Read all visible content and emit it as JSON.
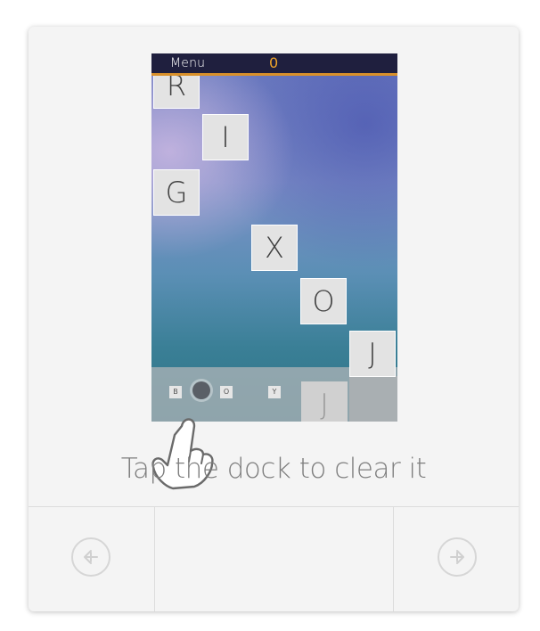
{
  "game": {
    "menu_label": "Menu",
    "score": "0",
    "accent_color": "#d9902a",
    "tiles": [
      "R",
      "I",
      "G",
      "X",
      "O",
      "J"
    ],
    "dock": {
      "small_letters": [
        "B",
        "O",
        "Y"
      ],
      "big_letter": "J"
    }
  },
  "tutorial": {
    "instruction": "Tap the dock to clear it"
  },
  "navigation": {
    "prev_icon": "arrow-left-circle-icon",
    "next_icon": "arrow-right-circle-icon"
  }
}
